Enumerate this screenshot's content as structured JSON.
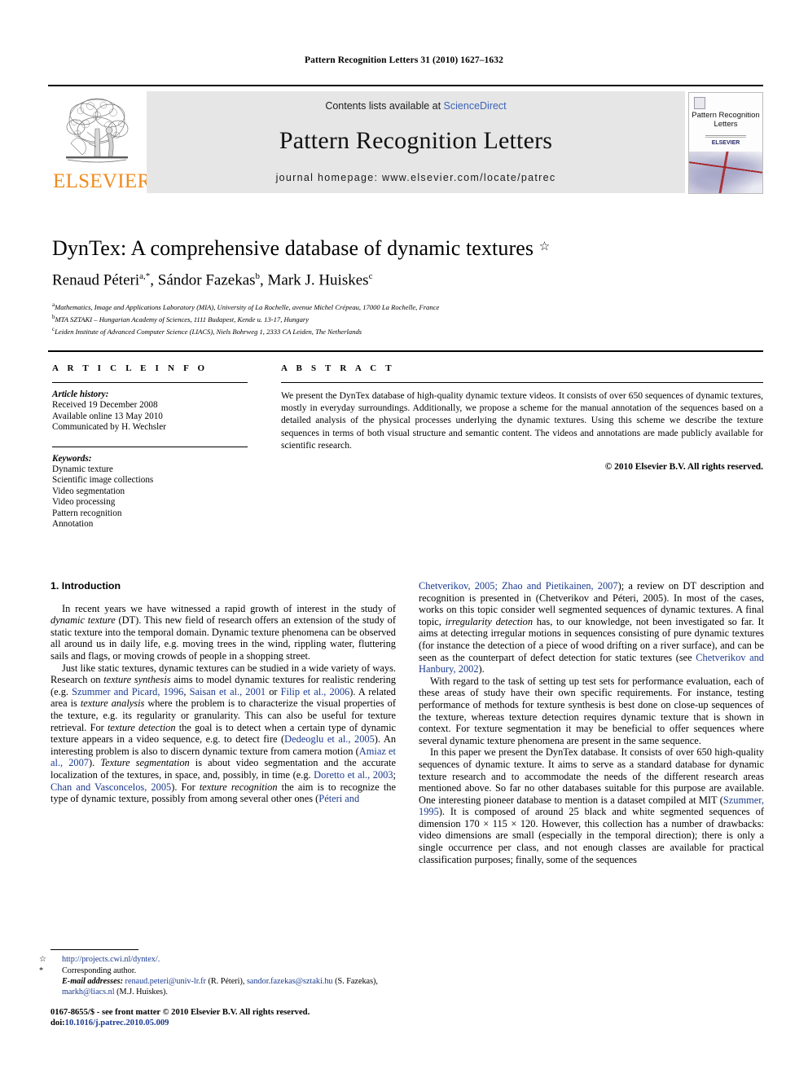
{
  "running_head": "Pattern Recognition Letters 31 (2010) 1627–1632",
  "masthead": {
    "publisher_name": "ELSEVIER",
    "contents_prefix": "Contents lists available at ",
    "contents_link": "ScienceDirect",
    "journal_title": "Pattern Recognition Letters",
    "homepage": "journal homepage: www.elsevier.com/locate/patrec",
    "cover": {
      "title_line1": "Pattern Recognition",
      "title_line2": "Letters",
      "publisher_mark": "ELSEVIER"
    },
    "link_color": "#3a63b8",
    "brand_color": "#F08A1E",
    "band_color": "#e6e6e6"
  },
  "article": {
    "title": "DynTex: A comprehensive database of dynamic textures",
    "title_mark": "☆",
    "authors": "Renaud Péteri, Sándor Fazekas, Mark J. Huiskes",
    "author_list": [
      {
        "name": "Renaud Péteri",
        "sup": "a,*"
      },
      {
        "name": "Sándor Fazekas",
        "sup": "b"
      },
      {
        "name": "Mark J. Huiskes",
        "sup": "c"
      }
    ],
    "affiliations": [
      {
        "mark": "a",
        "text": "Mathematics, Image and Applications Laboratory (MIA), University of La Rochelle, avenue Michel Crépeau, 17000 La Rochelle, France"
      },
      {
        "mark": "b",
        "text": "MTA SZTAKI – Hungarian Academy of Sciences, 1111 Budapest, Kende u. 13-17, Hungary"
      },
      {
        "mark": "c",
        "text": "Leiden Institute of Advanced Computer Science (LIACS), Niels Bohrweg 1, 2333 CA Leiden, The Netherlands"
      }
    ]
  },
  "article_info": {
    "heading": "A R T I C L E  I N F O",
    "history_label": "Article history:",
    "history": [
      "Received 19 December 2008",
      "Available online 13 May 2010",
      "Communicated by H. Wechsler"
    ],
    "keywords_label": "Keywords:",
    "keywords": [
      "Dynamic texture",
      "Scientific image collections",
      "Video segmentation",
      "Video processing",
      "Pattern recognition",
      "Annotation"
    ]
  },
  "abstract": {
    "heading": "A B S T R A C T",
    "text": "We present the DynTex database of high-quality dynamic texture videos. It consists of over 650 sequences of dynamic textures, mostly in everyday surroundings. Additionally, we propose a scheme for the manual annotation of the sequences based on a detailed analysis of the physical processes underlying the dynamic textures. Using this scheme we describe the texture sequences in terms of both visual structure and semantic content. The videos and annotations are made publicly available for scientific research.",
    "copyright": "© 2010 Elsevier B.V. All rights reserved."
  },
  "body": {
    "section_heading": "1. Introduction",
    "left_column": {
      "p1": "In recent years we have witnessed a rapid growth of interest in the study of dynamic texture (DT). This new field of research offers an extension of the study of static texture into the temporal domain. Dynamic texture phenomena can be observed all around us in daily life, e.g. moving trees in the wind, rippling water, fluttering sails and flags, or moving crowds of people in a shopping street.",
      "p1_italic_1": "dynamic texture",
      "p2_parts": {
        "a": "Just like static textures, dynamic textures can be studied in a wide variety of ways. Research on ",
        "i1": "texture synthesis",
        "b": " aims to model dynamic textures for realistic rendering (e.g. ",
        "r1": "Szummer and Picard, 1996",
        "c": ", ",
        "r2": "Saisan et al., 2001",
        "d": " or ",
        "r3": "Filip et al., 2006",
        "e": "). A related area is ",
        "i2": "texture analysis",
        "f": " where the problem is to characterize the visual properties of the texture, e.g. its regularity or granularity. This can also be useful for texture retrieval. For ",
        "i3": "texture detection",
        "g": " the goal is to detect when a certain type of dynamic texture appears in a video sequence, e.g. to detect fire (",
        "r4": "Dedeoglu et al., 2005",
        "h": "). An interesting problem is also to discern dynamic texture from camera motion (",
        "r5": "Amiaz et al., 2007",
        "i": "). ",
        "i4": "Texture segmentation",
        "j": " is about video segmentation and the accurate localization of the textures, in space, and, possibly, in time (e.g. ",
        "r6": "Doretto et al., 2003",
        "k": "; ",
        "r7": "Chan and Vasconcelos, 2005",
        "l": "). For ",
        "i5": "texture recognition",
        "m": " the aim is to recognize the type of dynamic texture, possibly from among several other ones (",
        "r8": "Péteri and"
      }
    },
    "right_column": {
      "p1_parts": {
        "r0": "Chetverikov, 2005; Zhao and Pietikainen, 2007",
        "a": "); a review on DT description and recognition is presented in (Chetverikov and Péteri, 2005). In most of the cases, works on this topic consider well segmented sequences of dynamic textures. A final topic, ",
        "i1": "irregularity detection",
        "b": " has, to our knowledge, not been investigated so far. It aims at detecting irregular motions in sequences consisting of pure dynamic textures (for instance the detection of a piece of wood drifting on a river surface), and can be seen as the counterpart of defect detection for static textures (see ",
        "r1": "Chetverikov and Hanbury, 2002",
        "c": ")."
      },
      "p2": "With regard to the task of setting up test sets for performance evaluation, each of these areas of study have their own specific requirements. For instance, testing performance of methods for texture synthesis is best done on close-up sequences of the texture, whereas texture detection requires dynamic texture that is shown in context. For texture segmentation it may be beneficial to offer sequences where several dynamic texture phenomena are present in the same sequence.",
      "p3_parts": {
        "a": "In this paper we present the DynTex database. It consists of over 650 high-quality sequences of dynamic texture. It aims to serve as a standard database for dynamic texture research and to accommodate the needs of the different research areas mentioned above. So far no other databases suitable for this purpose are available. One interesting pioneer database to mention is a dataset compiled at MIT (",
        "r1": "Szummer, 1995",
        "b": "). It is composed of around 25 black and white segmented sequences of dimension 170 × 115 × 120. However, this collection has a number of drawbacks: video dimensions are small (especially in the temporal direction); there is only a single occurrence per class, and not enough classes are available for practical classification purposes; finally, some of the sequences"
      }
    }
  },
  "footnotes": {
    "star_mark": "☆",
    "star_text": "http://projects.cwi.nl/dyntex/.",
    "corr_mark": "*",
    "corr_text": "Corresponding author.",
    "email_label": "E-mail addresses:",
    "emails": [
      {
        "addr": "renaud.peteri@univ-lr.fr",
        "who": " (R. Péteri), "
      },
      {
        "addr": "sandor.fazekas@sztaki.hu",
        "who": " (S. Fazekas), "
      },
      {
        "addr": "markh@liacs.nl",
        "who": " (M.J. Huiskes)."
      }
    ]
  },
  "imprint": {
    "line1": "0167-8655/$ - see front matter © 2010 Elsevier B.V. All rights reserved.",
    "doi_label": "doi:",
    "doi_value": "10.1016/j.patrec.2010.05.009"
  }
}
